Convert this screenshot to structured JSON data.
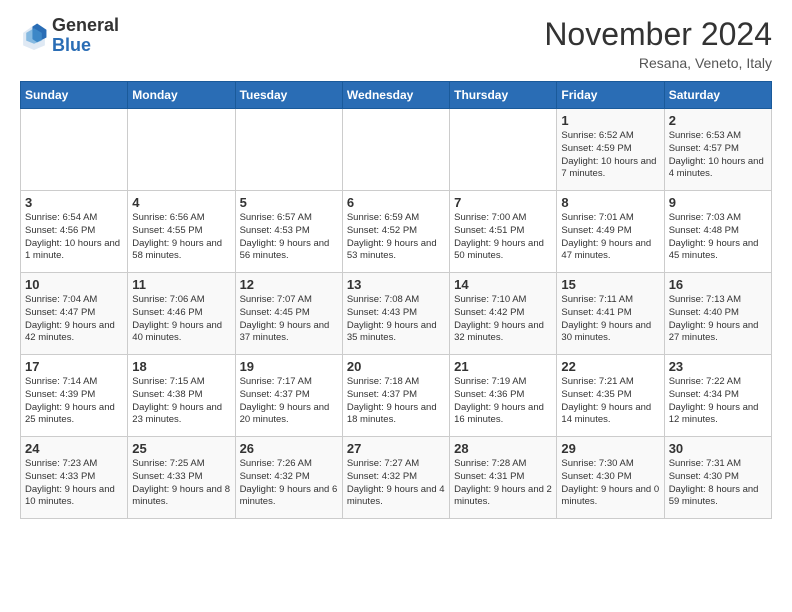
{
  "logo": {
    "general": "General",
    "blue": "Blue"
  },
  "title": "November 2024",
  "subtitle": "Resana, Veneto, Italy",
  "days_of_week": [
    "Sunday",
    "Monday",
    "Tuesday",
    "Wednesday",
    "Thursday",
    "Friday",
    "Saturday"
  ],
  "weeks": [
    [
      {
        "day": "",
        "info": ""
      },
      {
        "day": "",
        "info": ""
      },
      {
        "day": "",
        "info": ""
      },
      {
        "day": "",
        "info": ""
      },
      {
        "day": "",
        "info": ""
      },
      {
        "day": "1",
        "info": "Sunrise: 6:52 AM\nSunset: 4:59 PM\nDaylight: 10 hours and 7 minutes."
      },
      {
        "day": "2",
        "info": "Sunrise: 6:53 AM\nSunset: 4:57 PM\nDaylight: 10 hours and 4 minutes."
      }
    ],
    [
      {
        "day": "3",
        "info": "Sunrise: 6:54 AM\nSunset: 4:56 PM\nDaylight: 10 hours and 1 minute."
      },
      {
        "day": "4",
        "info": "Sunrise: 6:56 AM\nSunset: 4:55 PM\nDaylight: 9 hours and 58 minutes."
      },
      {
        "day": "5",
        "info": "Sunrise: 6:57 AM\nSunset: 4:53 PM\nDaylight: 9 hours and 56 minutes."
      },
      {
        "day": "6",
        "info": "Sunrise: 6:59 AM\nSunset: 4:52 PM\nDaylight: 9 hours and 53 minutes."
      },
      {
        "day": "7",
        "info": "Sunrise: 7:00 AM\nSunset: 4:51 PM\nDaylight: 9 hours and 50 minutes."
      },
      {
        "day": "8",
        "info": "Sunrise: 7:01 AM\nSunset: 4:49 PM\nDaylight: 9 hours and 47 minutes."
      },
      {
        "day": "9",
        "info": "Sunrise: 7:03 AM\nSunset: 4:48 PM\nDaylight: 9 hours and 45 minutes."
      }
    ],
    [
      {
        "day": "10",
        "info": "Sunrise: 7:04 AM\nSunset: 4:47 PM\nDaylight: 9 hours and 42 minutes."
      },
      {
        "day": "11",
        "info": "Sunrise: 7:06 AM\nSunset: 4:46 PM\nDaylight: 9 hours and 40 minutes."
      },
      {
        "day": "12",
        "info": "Sunrise: 7:07 AM\nSunset: 4:45 PM\nDaylight: 9 hours and 37 minutes."
      },
      {
        "day": "13",
        "info": "Sunrise: 7:08 AM\nSunset: 4:43 PM\nDaylight: 9 hours and 35 minutes."
      },
      {
        "day": "14",
        "info": "Sunrise: 7:10 AM\nSunset: 4:42 PM\nDaylight: 9 hours and 32 minutes."
      },
      {
        "day": "15",
        "info": "Sunrise: 7:11 AM\nSunset: 4:41 PM\nDaylight: 9 hours and 30 minutes."
      },
      {
        "day": "16",
        "info": "Sunrise: 7:13 AM\nSunset: 4:40 PM\nDaylight: 9 hours and 27 minutes."
      }
    ],
    [
      {
        "day": "17",
        "info": "Sunrise: 7:14 AM\nSunset: 4:39 PM\nDaylight: 9 hours and 25 minutes."
      },
      {
        "day": "18",
        "info": "Sunrise: 7:15 AM\nSunset: 4:38 PM\nDaylight: 9 hours and 23 minutes."
      },
      {
        "day": "19",
        "info": "Sunrise: 7:17 AM\nSunset: 4:37 PM\nDaylight: 9 hours and 20 minutes."
      },
      {
        "day": "20",
        "info": "Sunrise: 7:18 AM\nSunset: 4:37 PM\nDaylight: 9 hours and 18 minutes."
      },
      {
        "day": "21",
        "info": "Sunrise: 7:19 AM\nSunset: 4:36 PM\nDaylight: 9 hours and 16 minutes."
      },
      {
        "day": "22",
        "info": "Sunrise: 7:21 AM\nSunset: 4:35 PM\nDaylight: 9 hours and 14 minutes."
      },
      {
        "day": "23",
        "info": "Sunrise: 7:22 AM\nSunset: 4:34 PM\nDaylight: 9 hours and 12 minutes."
      }
    ],
    [
      {
        "day": "24",
        "info": "Sunrise: 7:23 AM\nSunset: 4:33 PM\nDaylight: 9 hours and 10 minutes."
      },
      {
        "day": "25",
        "info": "Sunrise: 7:25 AM\nSunset: 4:33 PM\nDaylight: 9 hours and 8 minutes."
      },
      {
        "day": "26",
        "info": "Sunrise: 7:26 AM\nSunset: 4:32 PM\nDaylight: 9 hours and 6 minutes."
      },
      {
        "day": "27",
        "info": "Sunrise: 7:27 AM\nSunset: 4:32 PM\nDaylight: 9 hours and 4 minutes."
      },
      {
        "day": "28",
        "info": "Sunrise: 7:28 AM\nSunset: 4:31 PM\nDaylight: 9 hours and 2 minutes."
      },
      {
        "day": "29",
        "info": "Sunrise: 7:30 AM\nSunset: 4:30 PM\nDaylight: 9 hours and 0 minutes."
      },
      {
        "day": "30",
        "info": "Sunrise: 7:31 AM\nSunset: 4:30 PM\nDaylight: 8 hours and 59 minutes."
      }
    ]
  ]
}
